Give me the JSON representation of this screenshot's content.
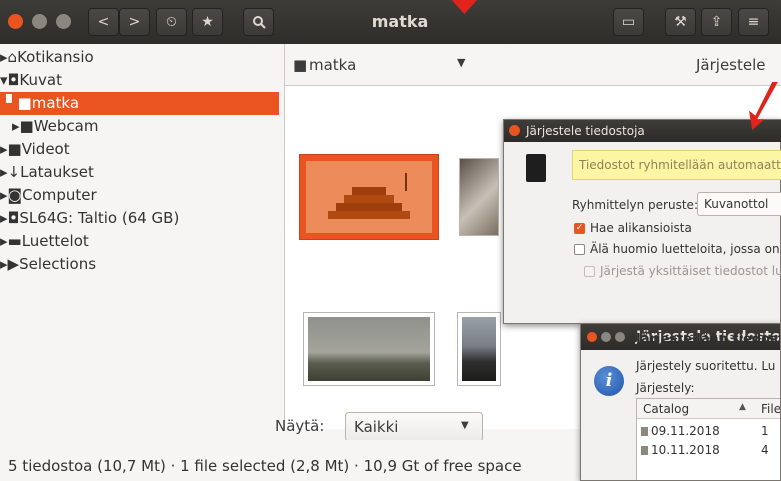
{
  "window": {
    "title": "matka"
  },
  "toolbar": {
    "back": "<",
    "forward": ">",
    "history_icon": "history-icon",
    "star_icon": "star-icon",
    "search_icon": "search-icon",
    "right_icons": [
      "slideshow-icon",
      "wrench-icon",
      "share-icon",
      "menu-icon"
    ]
  },
  "sidebar": {
    "items": [
      {
        "label": "Kotikansio",
        "prefix": "▸⌂"
      },
      {
        "label": "Kuvat",
        "prefix": "▾◘"
      },
      {
        "label": "matka",
        "prefix": "▘■"
      },
      {
        "label": "Webcam",
        "prefix": "▸■"
      },
      {
        "label": "Videot",
        "prefix": "▸■"
      },
      {
        "label": "Lataukset",
        "prefix": "▸↓"
      },
      {
        "label": "Computer",
        "prefix": "▸◙"
      },
      {
        "label": "SL64G: Taltio (64 GB)",
        "prefix": "▸◘"
      },
      {
        "label": "Luettelot",
        "prefix": "▸▬"
      },
      {
        "label": "Selections",
        "prefix": "▸▶"
      }
    ]
  },
  "location": {
    "folder": "matka",
    "sort_label": "Järjestele"
  },
  "filter": {
    "label": "Näytä:",
    "value": "Kaikki"
  },
  "status": {
    "text": "5 tiedostoa (10,7 Mt) · 1 file selected (2,8 Mt) · 10,9 Gt of free space"
  },
  "dialog1": {
    "title": "Järjestele tiedostoja",
    "info": "Tiedostot ryhmitellään automaattis",
    "group_label": "Ryhmittelyn peruste:",
    "group_value": "Kuvanottol",
    "check1": "Hae alikansioista",
    "check2": "Älä huomio luetteloita, jossa on v",
    "check3": "Järjestä yksittäiset tiedostot lue"
  },
  "dialog2": {
    "title": "Järjestele tiedostoja",
    "heading": "Järjestellään tiedosto",
    "desc": "Järjestely suoritettu. Lu",
    "list_label": "Järjestely:",
    "columns": [
      "Catalog",
      "File"
    ],
    "rows": [
      {
        "catalog": "09.11.2018",
        "files": "1"
      },
      {
        "catalog": "10.11.2018",
        "files": "4"
      }
    ]
  },
  "colors": {
    "accent": "#e95420",
    "titlebar": "#33322f"
  }
}
